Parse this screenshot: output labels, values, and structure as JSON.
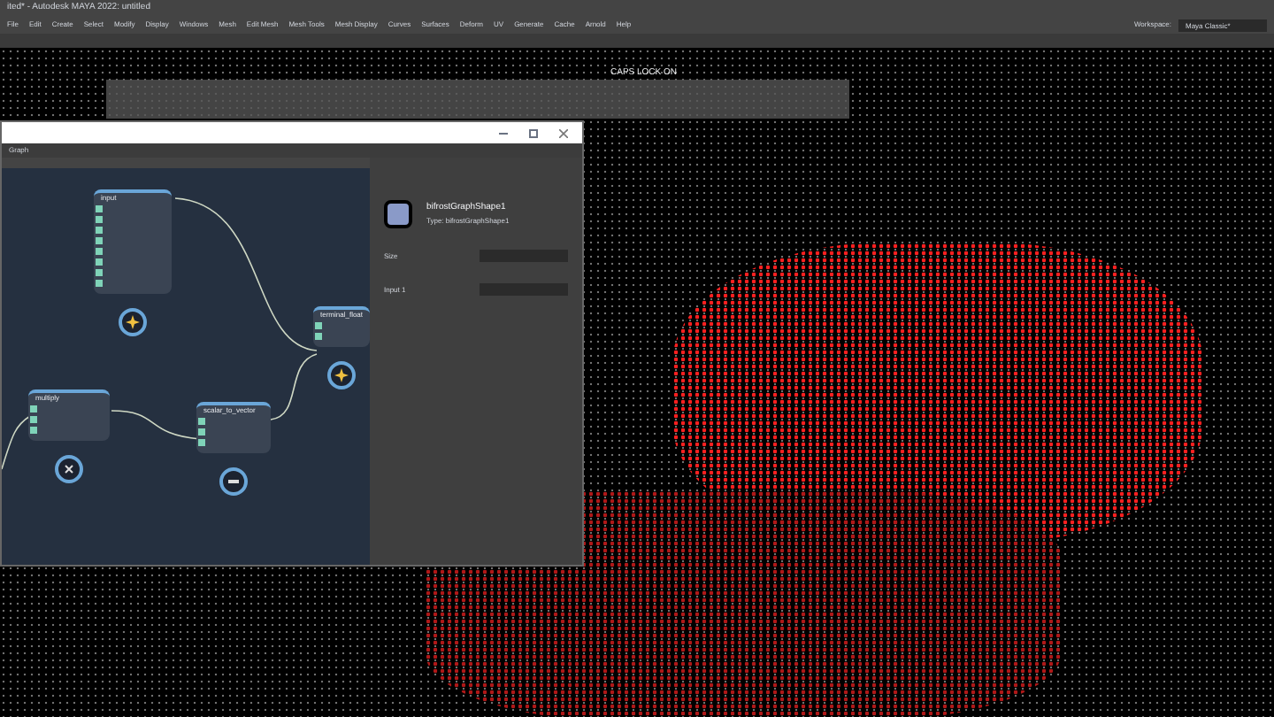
{
  "window": {
    "title": "ited* - Autodesk MAYA 2022: untitled"
  },
  "menu": [
    "File",
    "Edit",
    "Create",
    "Select",
    "Modify",
    "Display",
    "Windows",
    "Mesh",
    "Edit Mesh",
    "Mesh Tools",
    "Mesh Display",
    "Curves",
    "Surfaces",
    "Deform",
    "UV",
    "Generate",
    "Cache",
    "Arnold",
    "Help"
  ],
  "workspace": {
    "label": "Workspace:",
    "value": "Maya Classic*"
  },
  "viewport": {
    "notice": "CAPS LOCK ON"
  },
  "graph_window": {
    "title": "Graph",
    "nodes": [
      {
        "title": "input"
      },
      {
        "title": "multiply"
      },
      {
        "title": "scalar_to_vector"
      },
      {
        "title": "terminal_float"
      }
    ],
    "inspector": {
      "name": "bifrostGraphShape1",
      "type": "Type: bifrostGraphShape1",
      "fields": [
        {
          "label": "Size"
        },
        {
          "label": "Input 1"
        }
      ]
    }
  }
}
